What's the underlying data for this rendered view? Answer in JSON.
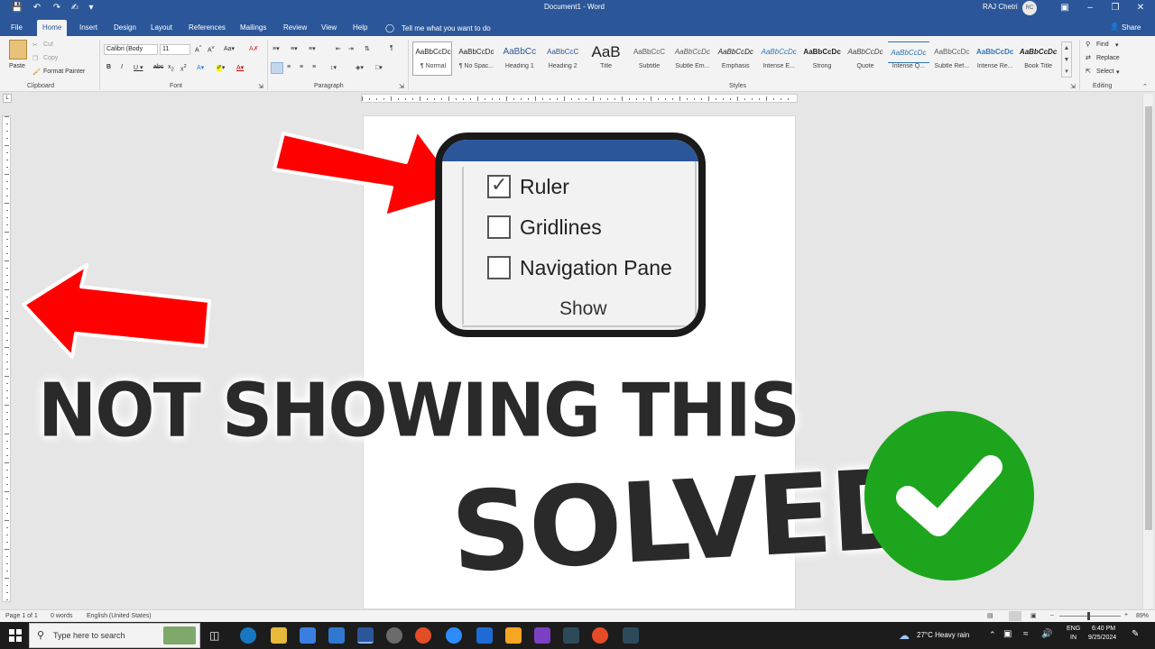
{
  "window": {
    "title": "Document1 - Word",
    "user": "RAJ Chetri",
    "user_initials": "RC",
    "share": "Share"
  },
  "tabs": [
    "File",
    "Home",
    "Insert",
    "Design",
    "Layout",
    "References",
    "Mailings",
    "Review",
    "View",
    "Help"
  ],
  "tell_me": "Tell me what you want to do",
  "ribbon": {
    "clipboard": {
      "paste": "Paste",
      "cut": "Cut",
      "copy": "Copy",
      "format_painter": "Format Painter",
      "label": "Clipboard"
    },
    "font": {
      "name": "Calibri (Body",
      "size": "11",
      "label": "Font"
    },
    "paragraph": {
      "label": "Paragraph"
    },
    "styles": {
      "label": "Styles",
      "items": [
        {
          "preview": "AaBbCcDc",
          "name": "¶ Normal"
        },
        {
          "preview": "AaBbCcDc",
          "name": "¶ No Spac..."
        },
        {
          "preview": "AaBbCc",
          "name": "Heading 1"
        },
        {
          "preview": "AaBbCcC",
          "name": "Heading 2"
        },
        {
          "preview": "AaB",
          "name": "Title"
        },
        {
          "preview": "AaBbCcC",
          "name": "Subtitle"
        },
        {
          "preview": "AaBbCcDc",
          "name": "Subtle Em..."
        },
        {
          "preview": "AaBbCcDc",
          "name": "Emphasis"
        },
        {
          "preview": "AaBbCcDc",
          "name": "Intense E..."
        },
        {
          "preview": "AaBbCcDc",
          "name": "Strong"
        },
        {
          "preview": "AaBbCcDc",
          "name": "Quote"
        },
        {
          "preview": "AaBbCcDc",
          "name": "Intense Q..."
        },
        {
          "preview": "AaBbCcDc",
          "name": "Subtle Ref..."
        },
        {
          "preview": "AaBbCcDc",
          "name": "Intense Re..."
        },
        {
          "preview": "AaBbCcDc",
          "name": "Book Title"
        }
      ]
    },
    "editing": {
      "find": "Find",
      "replace": "Replace",
      "select": "Select",
      "label": "Editing"
    }
  },
  "callout": {
    "items": [
      {
        "label": "Ruler",
        "checked": true
      },
      {
        "label": "Gridlines",
        "checked": false
      },
      {
        "label": "Navigation Pane",
        "checked": false
      }
    ],
    "group": "Show"
  },
  "overlay": {
    "line1": "NOT SHOWING THIS",
    "line2": "SOLVED"
  },
  "status": {
    "page": "Page 1 of 1",
    "words": "0 words",
    "language": "English (United States)",
    "zoom": "89%"
  },
  "taskbar": {
    "search": "Type here to search",
    "weather": "27°C  Heavy rain",
    "lang1": "ENG",
    "lang2": "IN",
    "time": "6:40 PM",
    "date": "9/25/2024"
  },
  "colors": {
    "word_blue": "#2b579a",
    "arrow_red": "#ff0000",
    "check_green": "#1ea51e"
  }
}
